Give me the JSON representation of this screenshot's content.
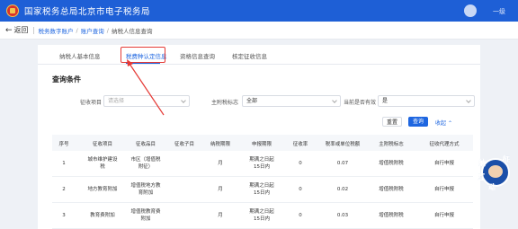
{
  "header": {
    "site_title": "国家税务总局北京市电子税务局",
    "username": "一级"
  },
  "breadcrumb": {
    "back_label": "返回",
    "items": [
      "税务数字账户",
      "账户查询",
      "纳税人信息查询"
    ]
  },
  "tabs": [
    {
      "label": "纳税人基本信息",
      "active": false
    },
    {
      "label": "税费种认定信息",
      "active": true
    },
    {
      "label": "资格信息查询",
      "active": false
    },
    {
      "label": "核定征收信息",
      "active": false
    }
  ],
  "section_title": "查询条件",
  "filters": {
    "levy_item": {
      "label": "征收项目",
      "placeholder": "请选择"
    },
    "main_tax_flag": {
      "label": "主附税标志",
      "value": "全部"
    },
    "currently_valid": {
      "label": "当前是否有效",
      "value": "是"
    }
  },
  "buttons": {
    "reset": "重置",
    "query": "查询",
    "collapse": "收起"
  },
  "table": {
    "columns": [
      "序号",
      "征收项目",
      "征收品目",
      "征收子目",
      "纳税期限",
      "申报期限",
      "征收率",
      "税率或单位税额",
      "主附税标志",
      "征收代理方式"
    ],
    "rows": [
      {
        "no": "1",
        "item": [
          "城市维护建设",
          "税"
        ],
        "sub_item": [
          "市区（增值税",
          "附征）"
        ],
        "sub_sub": "",
        "period": "月",
        "deadline": [
          "期满之日起",
          "15日内"
        ],
        "rate": "0",
        "tax_rate": "0.07",
        "flag": "增值税附税",
        "agent": "自行申报"
      },
      {
        "no": "2",
        "item": [
          "地方教育附加"
        ],
        "sub_item": [
          "增值税地方教",
          "育附加"
        ],
        "sub_sub": "",
        "period": "月",
        "deadline": [
          "期满之日起",
          "15日内"
        ],
        "rate": "0",
        "tax_rate": "0.02",
        "flag": "增值税附税",
        "agent": "自行申报"
      },
      {
        "no": "3",
        "item": [
          "教育费附加"
        ],
        "sub_item": [
          "增值税教育费",
          "附加"
        ],
        "sub_sub": "",
        "period": "月",
        "deadline": [
          "期满之日起",
          "15日内"
        ],
        "rate": "0",
        "tax_rate": "0.03",
        "flag": "增值税附税",
        "agent": "自行申报"
      }
    ]
  },
  "mascot": {
    "text": [
      "纳",
      "征",
      "互",
      "动"
    ]
  },
  "colors": {
    "primary": "#1e66e0",
    "header": "#1e5fd6",
    "annotation": "#e53935"
  }
}
